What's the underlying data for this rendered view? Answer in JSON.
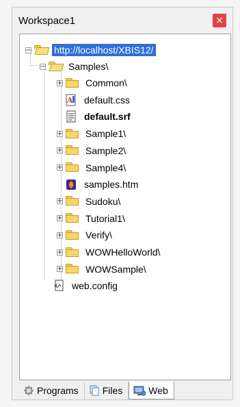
{
  "window": {
    "title": "Workspace1",
    "close_glyph": "×"
  },
  "tree": {
    "root": {
      "label": "http://localhost/XBIS12/"
    },
    "samples": {
      "label": "Samples\\"
    },
    "children": [
      {
        "label": "Common\\",
        "kind": "folder"
      },
      {
        "label": "default.css",
        "kind": "css"
      },
      {
        "label": "default.srf",
        "kind": "srf"
      },
      {
        "label": "Sample1\\",
        "kind": "folder"
      },
      {
        "label": "Sample2\\",
        "kind": "folder"
      },
      {
        "label": "Sample4\\",
        "kind": "folder"
      },
      {
        "label": "samples.htm",
        "kind": "htm"
      },
      {
        "label": "Sudoku\\",
        "kind": "folder"
      },
      {
        "label": "Tutorial1\\",
        "kind": "folder"
      },
      {
        "label": "Verify\\",
        "kind": "folder"
      },
      {
        "label": "WOWHelloWorld\\",
        "kind": "folder"
      },
      {
        "label": "WOWSample\\",
        "kind": "folder"
      }
    ],
    "web_config": {
      "label": "web.config"
    }
  },
  "tabs": [
    {
      "label": "Programs",
      "icon": "gear-icon"
    },
    {
      "label": "Files",
      "icon": "files-icon"
    },
    {
      "label": "Web",
      "icon": "web-icon",
      "active": true
    }
  ],
  "colors": {
    "selection": "#2f6fd6",
    "close": "#e04343",
    "folder": "#f7d56a"
  }
}
